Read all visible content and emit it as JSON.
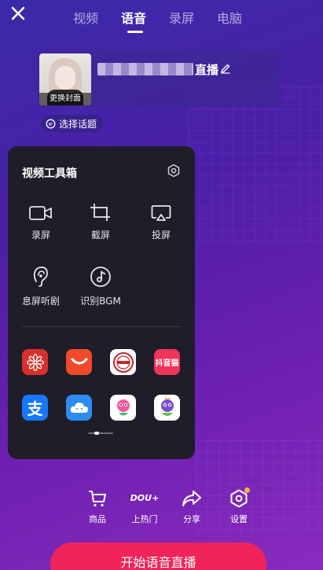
{
  "header": {
    "tabs": [
      {
        "label": "视频",
        "active": false
      },
      {
        "label": "语音",
        "active": true
      },
      {
        "label": "录屏",
        "active": false
      },
      {
        "label": "电脑",
        "active": false
      }
    ]
  },
  "cover": {
    "change_label": "更换封面",
    "title_suffix": "直播"
  },
  "topic": {
    "label": "选择话题"
  },
  "toolbox": {
    "title": "视频工具箱",
    "tools": [
      {
        "label": "录屏",
        "icon": "video-camera-icon"
      },
      {
        "label": "截屏",
        "icon": "crop-icon"
      },
      {
        "label": "投屏",
        "icon": "cast-icon"
      },
      {
        "label": "息屏听剧",
        "icon": "ear-icon"
      },
      {
        "label": "识别BGM",
        "icon": "music-note-icon"
      }
    ],
    "apps": [
      {
        "name": "huawei-flower-app-icon",
        "color": "#d9302c"
      },
      {
        "name": "smile-app-icon",
        "color": "#f04a2a"
      },
      {
        "name": "stamp-app-icon",
        "color": "#ffffff"
      },
      {
        "name": "douyin-mall-app-icon",
        "color": "#f0345a",
        "text": "抖音猫"
      },
      {
        "name": "alipay-app-icon",
        "color": "#1677ff",
        "text": "支"
      },
      {
        "name": "cloud-app-icon",
        "color": "#2d8cf0"
      },
      {
        "name": "pink-character-app-icon",
        "color": "#ffffff"
      },
      {
        "name": "green-character-app-icon",
        "color": "#ffffff"
      }
    ]
  },
  "bottom_actions": [
    {
      "label": "商品",
      "icon": "cart-icon"
    },
    {
      "label": "上热门",
      "icon": "dou-plus-icon",
      "icon_text": "DOU+"
    },
    {
      "label": "分享",
      "icon": "share-icon"
    },
    {
      "label": "设置",
      "icon": "settings-icon"
    }
  ],
  "start_button": {
    "label": "开始语音直播"
  }
}
